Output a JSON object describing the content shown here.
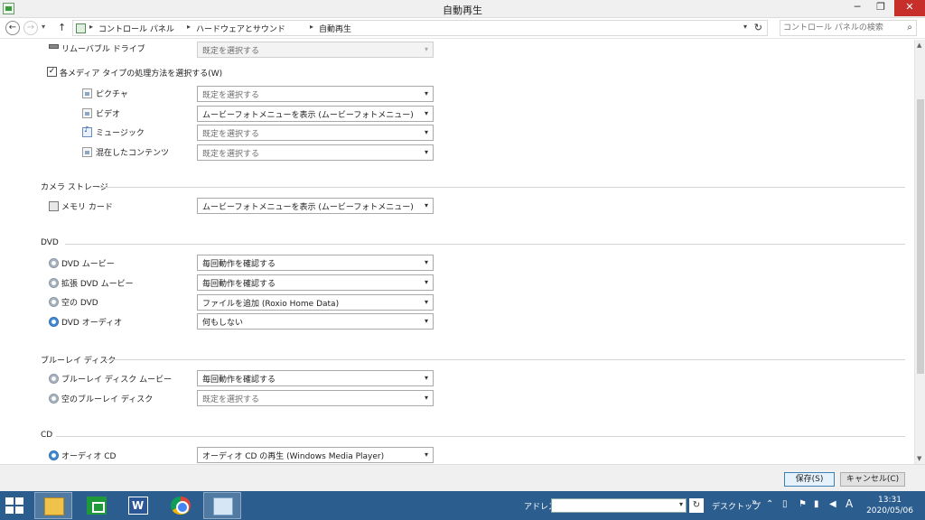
{
  "window": {
    "title": "自動再生",
    "minimize": "─",
    "maximize": "❐",
    "close": "✕"
  },
  "addressbar": {
    "breadcrumbs": [
      "コントロール パネル",
      "ハードウェアとサウンド",
      "自動再生"
    ],
    "search_placeholder": "コントロール パネルの検索"
  },
  "removable": {
    "label": "リムーバブル ドライブ",
    "value": "既定を選択する"
  },
  "media_types": {
    "checkbox_label": "各メディア タイプの処理方法を選択する(W)",
    "checked": true,
    "items": [
      {
        "label": "ピクチャ",
        "value": "既定を選択する",
        "placeholder": true,
        "icon": "picture-icon"
      },
      {
        "label": "ビデオ",
        "value": "ムービーフォトメニューを表示 (ムービーフォトメニュー)",
        "placeholder": false,
        "icon": "video-icon"
      },
      {
        "label": "ミュージック",
        "value": "既定を選択する",
        "placeholder": true,
        "icon": "music-icon"
      },
      {
        "label": "混在したコンテンツ",
        "value": "既定を選択する",
        "placeholder": true,
        "icon": "mixed-content-icon"
      }
    ]
  },
  "camera": {
    "heading": "カメラ ストレージ",
    "items": [
      {
        "label": "メモリ カード",
        "value": "ムービーフォトメニューを表示 (ムービーフォトメニュー)",
        "placeholder": false
      }
    ]
  },
  "dvd": {
    "heading": "DVD",
    "items": [
      {
        "label": "DVD ムービー",
        "value": "毎回動作を確認する",
        "placeholder": false
      },
      {
        "label": "拡張 DVD ムービー",
        "value": "毎回動作を確認する",
        "placeholder": false
      },
      {
        "label": "空の DVD",
        "value": "ファイルを追加 (Roxio Home Data)",
        "placeholder": false
      },
      {
        "label": "DVD オーディオ",
        "value": "何もしない",
        "placeholder": false
      }
    ]
  },
  "bluray": {
    "heading": "ブルーレイ ディスク",
    "items": [
      {
        "label": "ブルーレイ ディスク ムービー",
        "value": "毎回動作を確認する",
        "placeholder": false
      },
      {
        "label": "空のブルーレイ ディスク",
        "value": "既定を選択する",
        "placeholder": true
      }
    ]
  },
  "cd": {
    "heading": "CD",
    "items": [
      {
        "label": "オーディオ CD",
        "value": "オーディオ CD の再生 (Windows Media Player)",
        "placeholder": false
      }
    ]
  },
  "buttons": {
    "save": "保存(S)",
    "cancel": "キャンセル(C)"
  },
  "taskbar": {
    "address_label": "アドレス",
    "desktop_label": "デスクトップ",
    "ime": "A",
    "time": "13:31",
    "date": "2020/05/06"
  }
}
